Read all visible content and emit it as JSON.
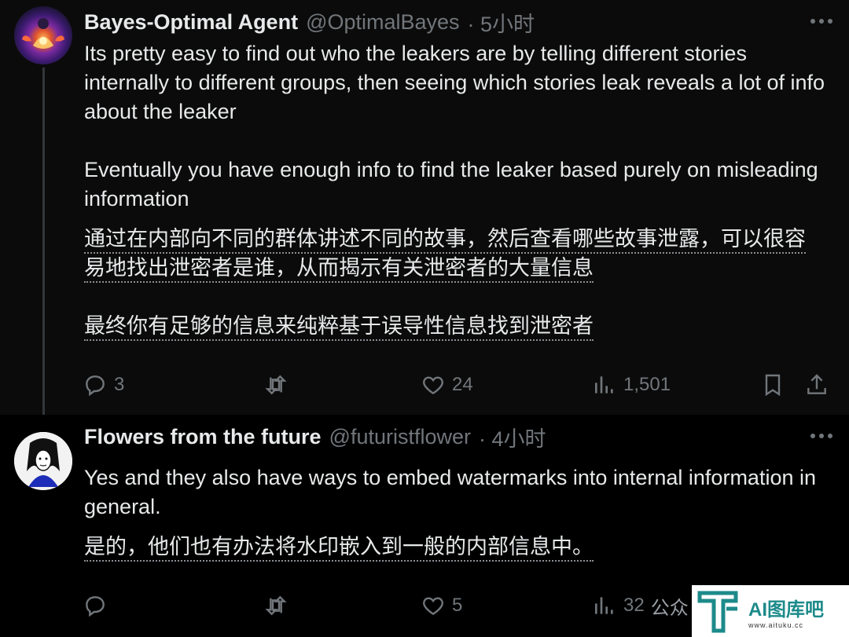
{
  "tweet1": {
    "author_name": "Bayes-Optimal Agent",
    "handle": "@OptimalBayes",
    "time": "· 5小时",
    "paragraphs": [
      "Its pretty easy to find out who the leakers are by telling different stories internally to different groups, then seeing which stories leak reveals a lot of info about the leaker",
      "Eventually you have enough info to find the leaker based purely on misleading information"
    ],
    "translation_lines": [
      "通过在内部向不同的群体讲述不同的故事，然后查看哪些故事泄露，可以很容",
      "易地找出泄密者是谁，从而揭示有关泄密者的大量信息",
      "最终你有足够的信息来纯粹基于误导性信息找到泄密者"
    ],
    "replies": "3",
    "reposts": "",
    "likes": "24",
    "views": "1,501"
  },
  "tweet2": {
    "author_name": "Flowers from the future",
    "handle": "@futuristflower",
    "time": "· 4小时",
    "text": "Yes and they also have ways to embed watermarks into internal information in general.",
    "translation": "是的，他们也有办法将水印嵌入到一般的内部信息中。",
    "replies": "",
    "reposts": "",
    "likes": "5",
    "views": "32"
  },
  "watermark": {
    "wechat_text": "公众",
    "brand": "AI图库吧",
    "url": "www.aituku.cc"
  },
  "colors": {
    "background": "#000000",
    "text": "#e7e9ea",
    "muted": "#71767b",
    "brand_teal": "#1d8a8a"
  }
}
